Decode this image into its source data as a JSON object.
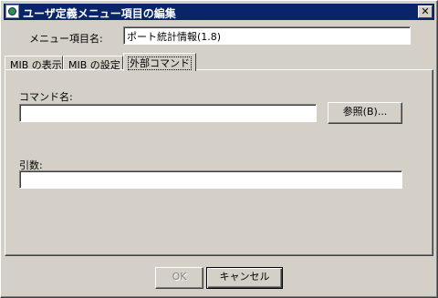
{
  "window": {
    "title": "ユーザ定義メニュー項目の編集",
    "close_label": "✕"
  },
  "menu_item_name": {
    "label": "メニュー項目名:",
    "value": "ポート統計情報(1.8)"
  },
  "tabs": [
    {
      "label": "MIB の表示",
      "active": false
    },
    {
      "label": "MIB の設定",
      "active": false
    },
    {
      "label": "外部コマンド",
      "active": true
    }
  ],
  "command": {
    "label": "コマンド名:",
    "value": "",
    "browse_label": "参照(B)..."
  },
  "arguments": {
    "label": "引数:",
    "value": ""
  },
  "footer": {
    "ok_label": "OK",
    "cancel_label": "キャンセル"
  }
}
